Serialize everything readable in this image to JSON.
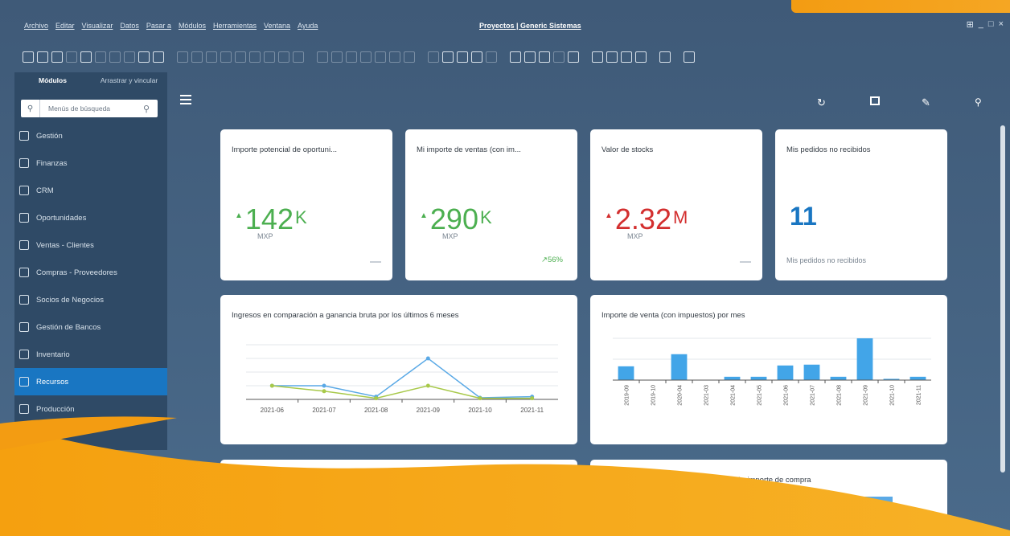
{
  "menu": [
    "Archivo",
    "Editar",
    "Visualizar",
    "Datos",
    "Pasar a",
    "Módulos",
    "Herramientas",
    "Ventana",
    "Ayuda"
  ],
  "app_title": "Proyectos | Generic Sistemas",
  "window_controls": [
    "⊞",
    "_",
    "□",
    "×"
  ],
  "sidebar": {
    "tabs": [
      "Módulos",
      "Arrastrar y vincular"
    ],
    "search_placeholder": "Menús de búsqueda",
    "items": [
      {
        "label": "Gestión",
        "icon": "gear-icon"
      },
      {
        "label": "Finanzas",
        "icon": "finance-icon"
      },
      {
        "label": "CRM",
        "icon": "crm-icon"
      },
      {
        "label": "Oportunidades",
        "icon": "opportunity-icon"
      },
      {
        "label": "Ventas - Clientes",
        "icon": "sales-icon"
      },
      {
        "label": "Compras - Proveedores",
        "icon": "purchase-icon"
      },
      {
        "label": "Socios de Negocios",
        "icon": "partners-icon"
      },
      {
        "label": "Gestión de Bancos",
        "icon": "bank-icon"
      },
      {
        "label": "Inventario",
        "icon": "inventory-icon"
      },
      {
        "label": "Recursos",
        "icon": "resources-icon",
        "active": true
      },
      {
        "label": "Producción",
        "icon": "production-icon"
      }
    ]
  },
  "header_icons": [
    "refresh-icon",
    "window-icon",
    "edit-icon",
    "search-icon"
  ],
  "kpis": [
    {
      "title": "Importe potencial de oportuni...",
      "value": "142",
      "unit": "K",
      "sub": "MXP",
      "color": "#4caf50",
      "arrow": "▲"
    },
    {
      "title": "Mi importe de ventas (con im...",
      "value": "290",
      "unit": "K",
      "sub": "MXP",
      "color": "#4caf50",
      "arrow": "▲",
      "trend": "↗56%"
    },
    {
      "title": "Valor de stocks",
      "value": "2.32",
      "unit": "M",
      "sub": "MXP",
      "color": "#d32f2f",
      "arrow": "▲"
    },
    {
      "title": "Mis pedidos no recibidos",
      "value": "11",
      "unit": "",
      "sub": "Mis pedidos no recibidos",
      "color": "#1976c2",
      "arrow": ""
    }
  ],
  "charts": {
    "line_title": "Ingresos en comparación a ganancia bruta por los últimos 6 meses",
    "bar_title": "Importe de venta (con impuestos) por mes",
    "bottom_title": "...comparados según importe de compra"
  },
  "chart_data": [
    {
      "type": "line",
      "title": "Ingresos en comparación a ganancia bruta por los últimos 6 meses",
      "categories": [
        "2021-06",
        "2021-07",
        "2021-08",
        "2021-09",
        "2021-10",
        "2021-11"
      ],
      "series": [
        {
          "values": [
            25,
            25,
            5,
            75,
            3,
            5
          ],
          "color": "#5aa9e6"
        },
        {
          "values": [
            25,
            15,
            2,
            25,
            2,
            2
          ],
          "color": "#a8c94a"
        }
      ],
      "ylim": [
        0,
        100
      ]
    },
    {
      "type": "bar",
      "title": "Importe de venta (con impuestos) por mes",
      "categories": [
        "2019-09",
        "2019-10",
        "2020-04",
        "2021-03",
        "2021-04",
        "2021-05",
        "2021-06",
        "2021-07",
        "2021-08",
        "2021-09",
        "2021-10",
        "2021-11"
      ],
      "values": [
        33,
        0,
        62,
        0,
        8,
        8,
        35,
        37,
        8,
        100,
        3,
        8
      ],
      "ylim": [
        0,
        100
      ]
    }
  ],
  "colors": {
    "accent": "#1976c2",
    "sidebar": "#2f4a66",
    "background": "#46627f",
    "orange": "#f5a00f"
  }
}
